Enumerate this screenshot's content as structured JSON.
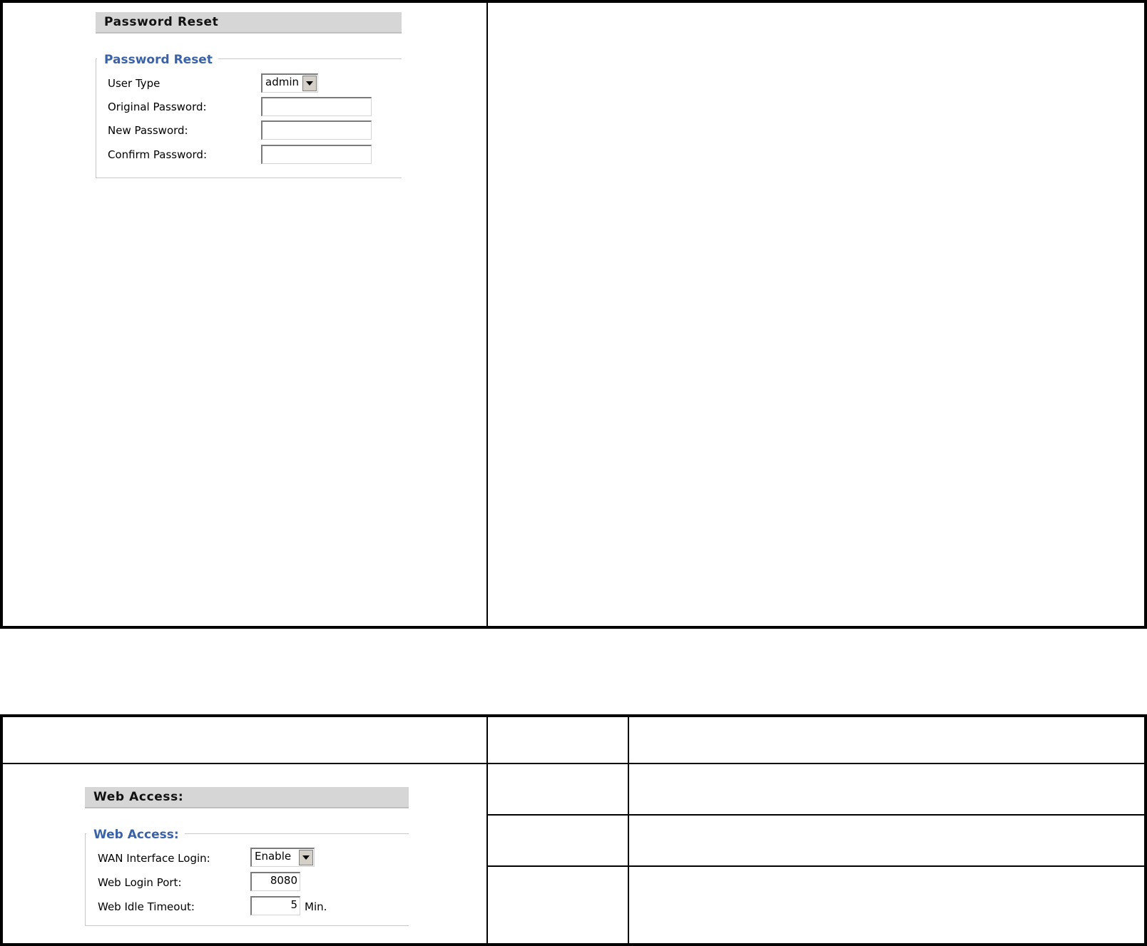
{
  "password_reset": {
    "header": "Password Reset",
    "legend": "Password Reset",
    "fields": [
      {
        "label": "User Type",
        "type": "select",
        "value": "admin"
      },
      {
        "label": "Original Password:",
        "type": "password",
        "value": ""
      },
      {
        "label": "New Password:",
        "type": "password",
        "value": ""
      },
      {
        "label": "Confirm Password:",
        "type": "password",
        "value": ""
      }
    ]
  },
  "web_access": {
    "header": "Web Access:",
    "legend": "Web Access:",
    "wan_login_label": "WAN Interface Login:",
    "wan_login_value": "Enable",
    "port_label": "Web Login Port:",
    "port_value": "8080",
    "timeout_label": "Web Idle Timeout:",
    "timeout_value": "5",
    "timeout_unit": "Min."
  }
}
